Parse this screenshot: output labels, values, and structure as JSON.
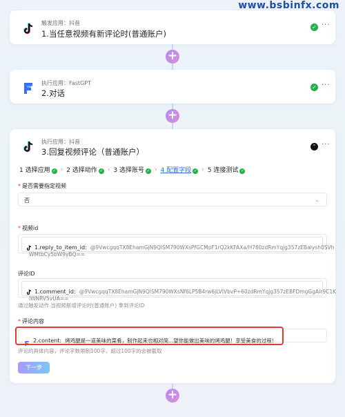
{
  "watermark": "www.bsbinfx.com",
  "trigger_card": {
    "sub": "触发应用：抖音",
    "title": "1.当任意视频有新评论时(普通账户)"
  },
  "action_card": {
    "sub": "执行应用：FastGPT",
    "title": "2.对话"
  },
  "reply_card": {
    "sub": "执行应用：抖音",
    "title": "3.回复视频评论（普通账户）",
    "steps": [
      {
        "label": "1 选择应用",
        "done": true
      },
      {
        "label": "2 选择动作",
        "done": true
      },
      {
        "label": "3 选择账号",
        "done": true
      },
      {
        "label": "4 配置字段",
        "done": true,
        "active": true
      },
      {
        "label": "5 连接测试",
        "done": true
      }
    ],
    "field_specify": {
      "label": "是否需要指定视频",
      "value": "否"
    },
    "field_video_id": {
      "label": "视频id",
      "ref_name": "1.reply_to_item_id:",
      "ref_value_line1": "@9VwcgqqTX8EhamGjN9QlSM790WXsPfGCMpF1rQ2kKFAXa/H760zdRmYqjg357zEBaIysh0SVh",
      "ref_value_line2": "WMtbCy5bW9yBQ=="
    },
    "field_comment_id": {
      "label": "评论ID",
      "ref_name": "1.comment_id:",
      "ref_value_line1": "@9VwcgqqTX8EhamGjN9QlSM790WXsNf6LP5B4rw6jLVIVbvP+60zdRmYqjg357zEBFDmgGgAIr9C1K",
      "ref_value_line2": "lWNRV5vUA==",
      "hint": "通过触发动作 当视频新增评论时(普通账户) 拿到评论ID"
    },
    "field_content": {
      "label": "评论内容",
      "ref_name": "2.content:",
      "ref_value": "烤鸡腿是一道美味的菜肴，制作起来也相对简...望你能做出美味的烤鸡腿！享受美食的过程！",
      "hint": "评论的具体内容，评论字数限制100字，超过100字的会被截取"
    },
    "next_label": "下一步"
  },
  "colors": {
    "accent": "#2f6fe0",
    "success": "#22b14c",
    "highlight": "#e23b2e",
    "plus_gradient_start": "#b58cf0"
  },
  "icons": {
    "trigger": "tiktok-icon",
    "action": "fastgpt-icon",
    "reply": "tiktok-icon"
  }
}
